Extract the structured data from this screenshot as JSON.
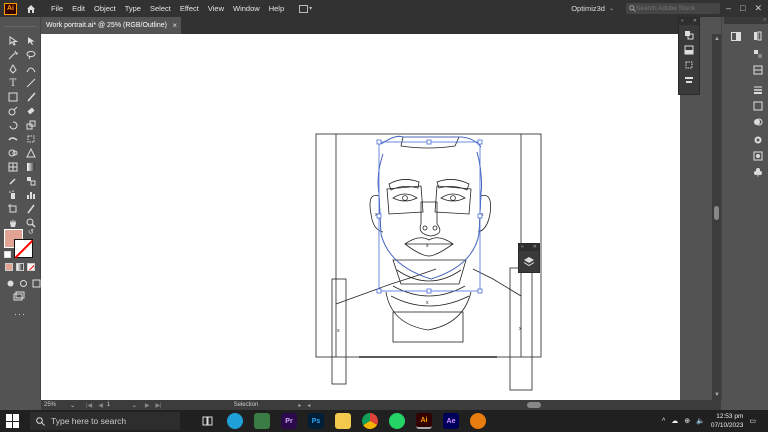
{
  "menubar": {
    "app_logo": "Ai",
    "items": [
      "File",
      "Edit",
      "Object",
      "Type",
      "Select",
      "Effect",
      "View",
      "Window",
      "Help"
    ],
    "workspace": "Optimiz3d",
    "stock_search_placeholder": "Search Adobe Stock"
  },
  "document": {
    "tab_title": "Work portrait.ai* @ 25% (RGB/Outline)",
    "close_label": "×"
  },
  "status": {
    "zoom": "25%",
    "page": "1",
    "tool": "Selection"
  },
  "taskbar": {
    "search_placeholder": "Type here to search",
    "apps": [
      {
        "name": "task-view",
        "label": "",
        "color": "#202020"
      },
      {
        "name": "edge",
        "label": "",
        "color": "#1fa0d8"
      },
      {
        "name": "app-green",
        "label": "",
        "color": "#3a7d44"
      },
      {
        "name": "premiere",
        "label": "Pr",
        "color": "#2a0a4a"
      },
      {
        "name": "photoshop",
        "label": "Ps",
        "color": "#001e36"
      },
      {
        "name": "file-explorer",
        "label": "",
        "color": "#f2c94c"
      },
      {
        "name": "chrome",
        "label": "",
        "color": "#db4437"
      },
      {
        "name": "whatsapp",
        "label": "",
        "color": "#25d366"
      },
      {
        "name": "illustrator",
        "label": "Ai",
        "color": "#330000"
      },
      {
        "name": "after-effects",
        "label": "Ae",
        "color": "#00005b"
      },
      {
        "name": "blender",
        "label": "",
        "color": "#e87d0d"
      }
    ],
    "time": "12:53 pm",
    "date": "07/10/2023"
  },
  "colors": {
    "fill": "#e0a394",
    "stroke": "#ffffff",
    "selection": "#4a6fd8"
  }
}
